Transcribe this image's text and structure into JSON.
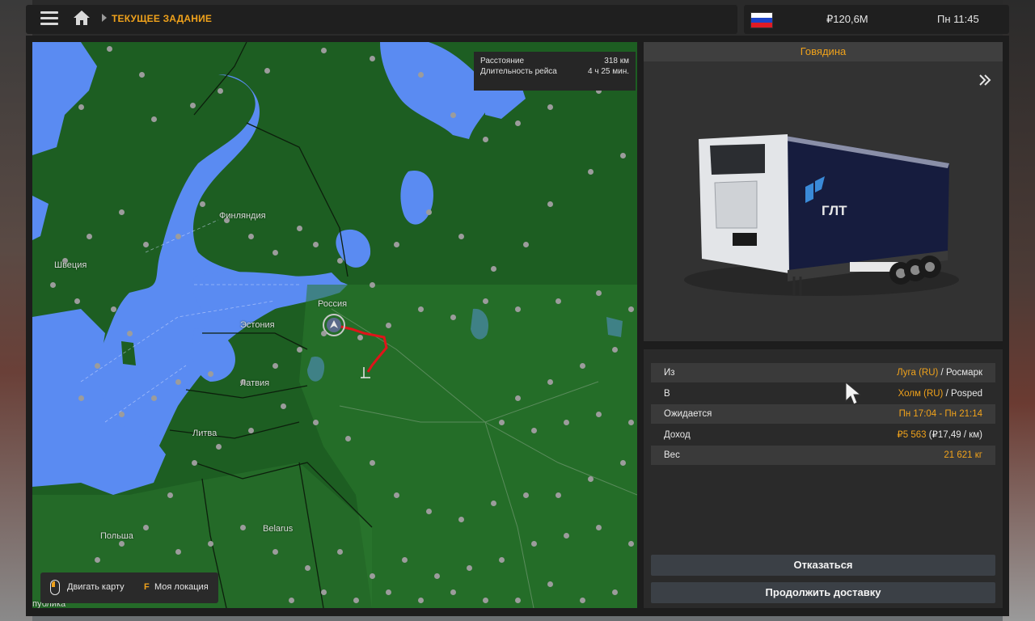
{
  "header": {
    "breadcrumb": "ТЕКУЩЕЕ ЗАДАНИЕ",
    "menu_icon": "hamburger-icon",
    "home_icon": "home-icon",
    "country_flag": "russia-flag",
    "money": "₽120,6M",
    "time": "Пн 11:45"
  },
  "map": {
    "labels": {
      "finland": "Финляндия",
      "sweden": "Швеция",
      "estonia": "Эстония",
      "russia": "Россия",
      "latvia": "Латвия",
      "lithuania": "Литва",
      "poland": "Польша",
      "belarus": "Belarus",
      "republic": "публика"
    },
    "stats": {
      "distance_label": "Расстояние",
      "distance_value": "318 км",
      "duration_label": "Длительность рейса",
      "duration_value": "4 ч 25 мин."
    },
    "help": {
      "move_map": "Двигать карту",
      "key_f": "F",
      "my_location": "Моя локация"
    },
    "colors": {
      "land": "#1d5e22",
      "water": "#5a8bf2",
      "route": "#e0141a"
    }
  },
  "cargo": {
    "name": "Говядина",
    "trailer_brand": "ГЛТ"
  },
  "job": {
    "rows": [
      {
        "key": "Из",
        "city": "Луга (RU)",
        "sep": " / ",
        "company": "Росмарк"
      },
      {
        "key": "В",
        "city": "Холм (RU)",
        "sep": " / ",
        "company": "Posped"
      },
      {
        "key": "Ожидается",
        "city": "Пн 17:04 - Пн 21:14",
        "sep": "",
        "company": ""
      },
      {
        "key": "Доход",
        "city": "₽5 563",
        "sep": "",
        "company": " (₽17,49 / км)"
      },
      {
        "key": "Вес",
        "city": "21 621 кг",
        "sep": "",
        "company": ""
      }
    ]
  },
  "buttons": {
    "cancel": "Отказаться",
    "continue": "Продолжить доставку"
  },
  "accent_color": "#f0a21b"
}
